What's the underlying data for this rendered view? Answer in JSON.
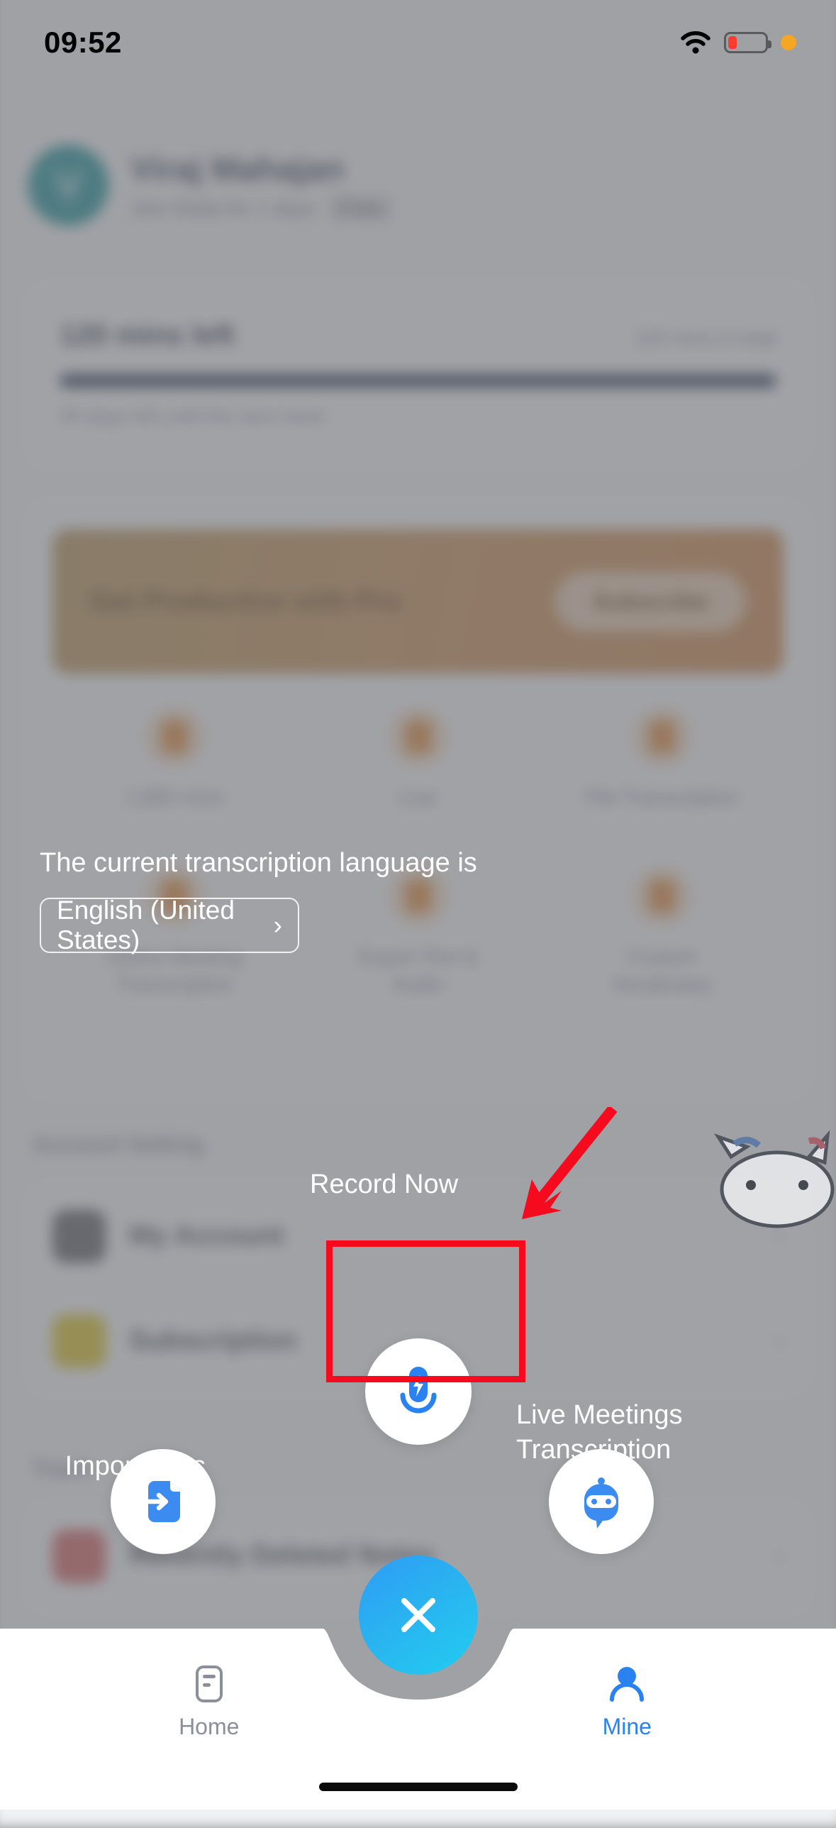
{
  "status_bar": {
    "time": "09:52",
    "wifi_icon": "wifi-icon",
    "battery_icon": "battery-low-icon",
    "recording_dot_icon": "orange-status-dot"
  },
  "profile": {
    "avatar_initial": "V",
    "avatar_color": "#1d9199",
    "name": "Viraj Mahajan",
    "joined": "Join Notta for 1 days",
    "plan_badge": "Free"
  },
  "minutes_card": {
    "remaining": "120 mins left",
    "total": "120 mins in total",
    "progress_percent": 100,
    "reset_note": "30 days left until the next reset",
    "bar_color": "#35435c"
  },
  "pro_banner": {
    "title": "Get Productive with Pro",
    "button_label": "Subscribe",
    "gradient_from": "#b59258",
    "gradient_to": "#cb8449"
  },
  "features": [
    {
      "label": "1,800 mins",
      "icon": "clock-icon"
    },
    {
      "label": "Live",
      "icon": "microphone-icon"
    },
    {
      "label": "File\nTranscription",
      "icon": "file-icon"
    },
    {
      "label": "Online Meeting\nTranscription",
      "icon": "meeting-icon"
    },
    {
      "label": "Export\nText & Audio",
      "icon": "export-icon"
    },
    {
      "label": "Custom\nVocabulary",
      "icon": "vocabulary-icon"
    }
  ],
  "account_section": {
    "title": "Account Setting",
    "rows": [
      {
        "label": "My Account",
        "icon": "person-icon",
        "icon_color": "#5c6067",
        "chevron": "›"
      },
      {
        "label": "Subscription",
        "icon": "subscription-icon",
        "icon_color": "#d9c024",
        "chevron": "›"
      }
    ]
  },
  "trash_section": {
    "title": "Trash",
    "rows": [
      {
        "label": "Recently Deleted Notes",
        "icon": "trash-icon",
        "icon_color": "#d26262",
        "chevron": "›"
      }
    ]
  },
  "language_prompt": {
    "title": "The current transcription language is",
    "value": "English (United States)",
    "chevron": "›"
  },
  "action_sheet": {
    "record": {
      "label": "Record Now",
      "icon": "microphone-bolt-icon"
    },
    "import": {
      "label": "Import Files",
      "icon": "file-import-icon"
    },
    "live": {
      "label_line1": "Live Meetings",
      "label_line2": "Transcription",
      "icon": "bot-chat-icon"
    },
    "close": {
      "label": "Close",
      "icon": "close-x-icon",
      "gradient_from": "#2e9bf5",
      "gradient_to": "#22cdf0"
    },
    "accent_color": "#2a82f0"
  },
  "annotation": {
    "highlight_target": "Record Now",
    "box_color": "#f50a1e",
    "arrow_icon": "red-arrow-icon"
  },
  "tab_bar": {
    "tabs": [
      {
        "label": "Home",
        "icon": "note-icon",
        "active": false
      },
      {
        "label": "Mine",
        "icon": "person-icon",
        "active": true
      }
    ],
    "active_color": "#2a82f0",
    "inactive_color": "#8a9099"
  }
}
